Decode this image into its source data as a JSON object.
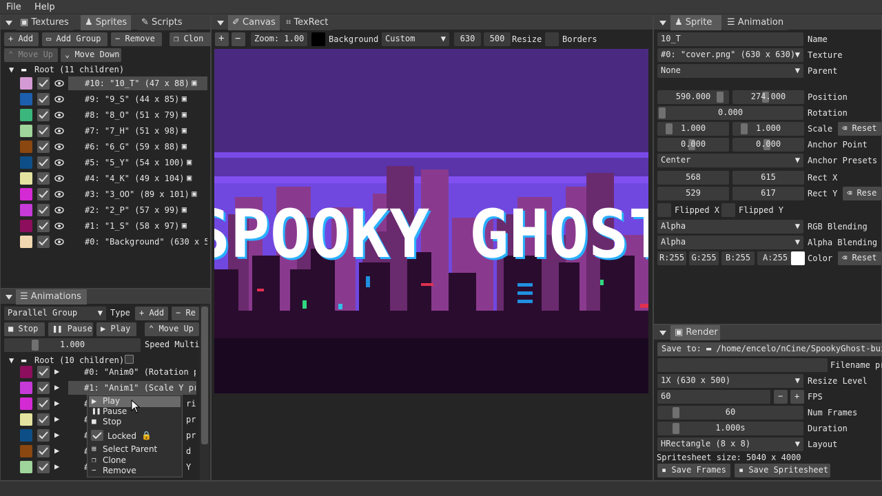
{
  "menu": {
    "file": "File",
    "help": "Help"
  },
  "left_top": {
    "tabs": [
      "Textures",
      "Sprites",
      "Scripts"
    ],
    "toolbar": {
      "add": "Add",
      "add_group": "Add Group",
      "remove": "Remove",
      "clone": "Clon",
      "move_up": "Move Up",
      "move_down": "Move Down"
    },
    "root_label": "Root (11 children)",
    "items": [
      {
        "label": "#10: \"10_T\" (47 x 88)",
        "color": "#d49ad4",
        "selected": true
      },
      {
        "label": "#9: \"9_S\" (44 x 85)",
        "color": "#1c5fae"
      },
      {
        "label": "#8: \"8_O\" (51 x 79)",
        "color": "#3bb67c"
      },
      {
        "label": "#7: \"7_H\" (51 x 98)",
        "color": "#9fd49a"
      },
      {
        "label": "#6: \"6_G\" (59 x 88)",
        "color": "#8a4710"
      },
      {
        "label": "#5: \"5_Y\" (54 x 100)",
        "color": "#0e4e86"
      },
      {
        "label": "#4: \"4_K\" (49 x 104)",
        "color": "#e4e4a0"
      },
      {
        "label": "#3: \"3_OO\" (89 x 101)",
        "color": "#d42ad4"
      },
      {
        "label": "#2: \"2_P\" (57 x 99)",
        "color": "#c63ad8"
      },
      {
        "label": "#1: \"1_S\" (58 x 97)",
        "color": "#8c0e5c"
      },
      {
        "label": "#0: \"Background\" (630 x 50",
        "color": "#f2d8b0"
      }
    ]
  },
  "anim_panel": {
    "tab": "Animations",
    "type_select": "Parallel Group",
    "type_label": "Type",
    "add": "Add",
    "remove": "Re",
    "stop": "Stop",
    "pause": "Pause",
    "play": "Play",
    "move_up": "Move Up",
    "speed_value": "1.000",
    "speed_label": "Speed Multi",
    "root_label": "Root (10 children)",
    "items": [
      {
        "label": "#0: \"Anim0\" (Rotation p",
        "color": "#8c0e5c"
      },
      {
        "label": "#1: \"Anim1\" (Scale Y pr",
        "color": "#c63ad8",
        "selected": true
      },
      {
        "label": "#",
        "suffix": "ri",
        "color": "#d42ad4"
      },
      {
        "label": "#",
        "suffix": "pr",
        "color": "#e4e4a0"
      },
      {
        "label": "#",
        "suffix": "pr",
        "color": "#0e4e86"
      },
      {
        "label": "#",
        "suffix": "d",
        "color": "#8a4710"
      },
      {
        "label": "#",
        "suffix": "Y",
        "color": "#9fd49a"
      }
    ]
  },
  "context_menu": {
    "play": "Play",
    "pause": "Pause",
    "stop": "Stop",
    "locked": "Locked",
    "select_parent": "Select Parent",
    "clone": "Clone",
    "remove": "Remove"
  },
  "canvas_panel": {
    "tabs": [
      "Canvas",
      "TexRect"
    ],
    "zoom": "Zoom: 1.00",
    "background_label": "Background",
    "background_select": "Custom",
    "width": "630",
    "height": "500",
    "resize": "Resize",
    "borders": "Borders",
    "title_text": "SPOOKY GHOST"
  },
  "sprite_panel": {
    "tabs": [
      "Sprite",
      "Animation"
    ],
    "name_value": "10_T",
    "name_label": "Name",
    "texture_value": "#0: \"cover.png\" (630 x 630)",
    "texture_label": "Texture",
    "parent_value": "None",
    "parent_label": "Parent",
    "pos_x": "590.000",
    "pos_y": "274.000",
    "position_label": "Position",
    "rotation": "0.000",
    "rotation_label": "Rotation",
    "scale_x": "1.000",
    "scale_y": "1.000",
    "scale_label": "Scale",
    "reset": "Reset",
    "anchor_x": "0.000",
    "anchor_y": "0.000",
    "anchor_label": "Anchor Point",
    "anchor_preset": "Center",
    "anchor_presets_label": "Anchor Presets",
    "rect_x1": "568",
    "rect_x2": "615",
    "rect_x_label": "Rect X",
    "rect_y1": "529",
    "rect_y2": "617",
    "rect_y_label": "Rect Y",
    "reset_short": "Rese",
    "flipped_x": "Flipped X",
    "flipped_y": "Flipped Y",
    "rgb_blend": "Alpha",
    "rgb_blend_label": "RGB Blending",
    "alpha_blend": "Alpha",
    "alpha_blend_label": "Alpha Blending",
    "r": "R:255",
    "g": "G:255",
    "b": "B:255",
    "a": "A:255",
    "color_label": "Color"
  },
  "render_panel": {
    "tab": "Render",
    "save_to": "Save to:",
    "save_path": "/home/encelo/nCine/SpookyGhost-bui",
    "filename_prefix": "Filename prefix",
    "resize_level": "1X (630 x 500)",
    "resize_level_label": "Resize Level",
    "fps_value": "60",
    "fps_label": "FPS",
    "num_frames": "60",
    "num_frames_label": "Num Frames",
    "duration": "1.000s",
    "duration_label": "Duration",
    "layout": "HRectangle (8 x 8)",
    "layout_label": "Layout",
    "spritesheet_size": "Spritesheet size: 5040 x 4000",
    "save_frames": "Save Frames",
    "save_spritesheet": "Save Spritesheet"
  },
  "colors": {
    "accent": "#4d4d4d",
    "canvas_sky": "#4a2a80",
    "canvas_purple": "#7048e0"
  }
}
